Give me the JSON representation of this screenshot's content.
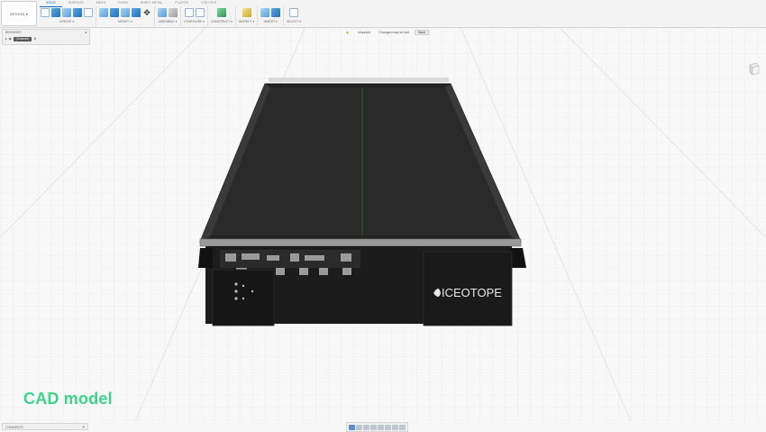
{
  "workspace": {
    "label": "DESIGN ▾"
  },
  "tabs": [
    "SOLID",
    "SURFACE",
    "MESH",
    "FORM",
    "SHEET METAL",
    "PLASTIC",
    "UTILITIES"
  ],
  "active_tab": "SOLID",
  "groups": {
    "create": "CREATE ▾",
    "modify": "MODIFY ▾",
    "assemble": "ASSEMBLE ▾",
    "configure": "CONFIGURE ▾",
    "construct": "CONSTRUCT ▾",
    "inspect": "INSPECT ▾",
    "insert": "INSERT ▾",
    "select": "SELECT ▾"
  },
  "browser": {
    "title": "BROWSER",
    "document": "(Unsaved)"
  },
  "save_bar": {
    "status": "Unsaved",
    "message": "Changes may be lost",
    "save": "Save"
  },
  "model": {
    "brand": "ICEOTOPE"
  },
  "overlay": {
    "label": "CAD model"
  },
  "comments": {
    "title": "COMMENTS"
  },
  "colors": {
    "accent": "#0a6fd1",
    "overlay_green": "#3ed38a",
    "chassis": "#1c1c1c"
  }
}
